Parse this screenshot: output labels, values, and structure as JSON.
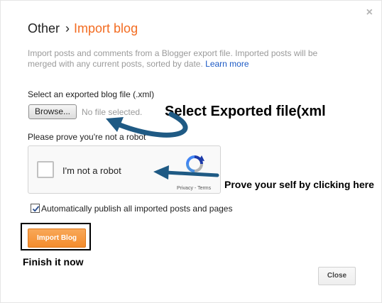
{
  "dialog": {
    "close_glyph": "×",
    "breadcrumb": {
      "parent": "Other",
      "separator": "›",
      "current": "Import blog"
    },
    "description": "Import posts and comments from a Blogger export file. Imported posts will be merged with any current posts, sorted by date.",
    "learn_more": "Learn more",
    "select_file_label": "Select an exported blog file (.xml)",
    "browse_button": "Browse...",
    "no_file_text": "No file selected.",
    "prove_label": "Please prove you're not a robot",
    "recaptcha": {
      "label": "I'm not a robot",
      "privacy": "Privacy",
      "separator": "-",
      "terms": "Terms",
      "checked": false
    },
    "auto_publish": {
      "label": "Automatically publish all imported posts and pages",
      "checked": true
    },
    "import_button": "Import Blog",
    "close_button": "Close"
  },
  "annotations": {
    "select_exported": "Select Exported file(xml",
    "prove_yourself": "Prove your self by clicking here",
    "finish": "Finish it now"
  },
  "colors": {
    "accent": "#f36c21",
    "link": "#1c5ac5",
    "import_button": "#f6a04d",
    "annotation_arrow": "#1f5a84"
  },
  "icons": {
    "close": "close-icon",
    "recaptcha": "recaptcha-logo-icon",
    "checkbox": "checkmark-icon"
  }
}
